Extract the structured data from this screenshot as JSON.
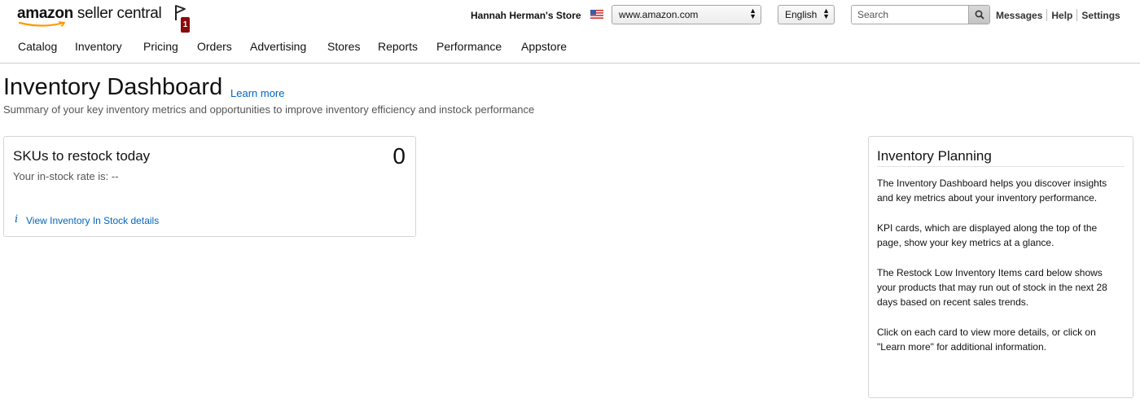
{
  "header": {
    "logo_brand": "amazon",
    "logo_product": " seller central",
    "notification_count": "1",
    "store_name": "Hannah Herman's Store",
    "marketplace": "www.amazon.com",
    "language": "English",
    "search_placeholder": "Search",
    "links": [
      "Messages",
      "Help",
      "Settings"
    ]
  },
  "nav": {
    "items": [
      "Catalog",
      "Inventory",
      "Pricing",
      "Orders",
      "Advertising",
      "Stores",
      "Reports",
      "Performance",
      "Appstore"
    ]
  },
  "page": {
    "title": "Inventory Dashboard",
    "learn_more": "Learn more",
    "subtitle": "Summary of your key inventory metrics and opportunities to improve inventory efficiency and instock performance"
  },
  "kpi_card": {
    "title": "SKUs to restock today",
    "value": "0",
    "subtitle": "Your in-stock rate is: --",
    "info_glyph": "i",
    "link": "View Inventory In Stock details"
  },
  "planning": {
    "title": "Inventory Planning",
    "paragraphs": [
      "The Inventory Dashboard helps you discover insights and key metrics about your inventory performance.",
      "KPI cards, which are displayed along the top of the page, show your key metrics at a glance.",
      "The Restock Low Inventory Items card below shows your products that may run out of stock in the next 28 days based on recent sales trends.",
      "Click on each card to view more details, or click on \"Learn more\" for additional information."
    ]
  },
  "colors": {
    "link": "#0066c0",
    "badge": "#8b0a0a",
    "smile": "#f90"
  }
}
